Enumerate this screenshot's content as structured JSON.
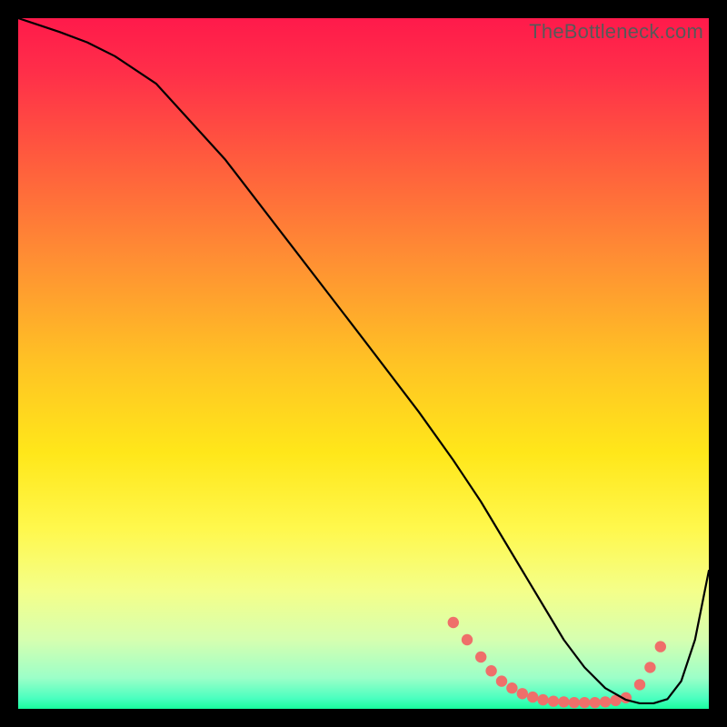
{
  "watermark": "TheBottleneck.com",
  "chart_data": {
    "type": "line",
    "title": "",
    "xlabel": "",
    "ylabel": "",
    "xlim": [
      0,
      100
    ],
    "ylim": [
      0,
      100
    ],
    "grid": false,
    "legend": false,
    "background_gradient_stops": [
      {
        "offset": 0,
        "color": "#ff1a4b"
      },
      {
        "offset": 0.08,
        "color": "#ff2f49"
      },
      {
        "offset": 0.2,
        "color": "#ff5a3e"
      },
      {
        "offset": 0.35,
        "color": "#ff8f33"
      },
      {
        "offset": 0.5,
        "color": "#ffc324"
      },
      {
        "offset": 0.63,
        "color": "#ffe71a"
      },
      {
        "offset": 0.74,
        "color": "#fff84d"
      },
      {
        "offset": 0.83,
        "color": "#f4ff8a"
      },
      {
        "offset": 0.9,
        "color": "#d6ffb0"
      },
      {
        "offset": 0.955,
        "color": "#9cffc8"
      },
      {
        "offset": 0.985,
        "color": "#4affbf"
      },
      {
        "offset": 1.0,
        "color": "#18ff9e"
      }
    ],
    "series": [
      {
        "name": "curve",
        "color": "#000000",
        "width": 2.2,
        "x": [
          0,
          3,
          6,
          10,
          14,
          20,
          30,
          40,
          50,
          58,
          63,
          67,
          70,
          73,
          76,
          79,
          82,
          85,
          88,
          90,
          92,
          94,
          96,
          98,
          100
        ],
        "y": [
          100,
          99,
          98,
          96.5,
          94.5,
          90.5,
          79.5,
          66.5,
          53.5,
          43,
          36,
          30,
          25,
          20,
          15,
          10,
          6,
          3,
          1.3,
          0.8,
          0.8,
          1.4,
          4,
          10,
          20
        ]
      }
    ],
    "markers": {
      "name": "trough-dots",
      "color": "#ef6f6a",
      "radius": 6.2,
      "points": [
        {
          "x": 63.0,
          "y": 12.5
        },
        {
          "x": 65.0,
          "y": 10.0
        },
        {
          "x": 67.0,
          "y": 7.5
        },
        {
          "x": 68.5,
          "y": 5.5
        },
        {
          "x": 70.0,
          "y": 4.0
        },
        {
          "x": 71.5,
          "y": 3.0
        },
        {
          "x": 73.0,
          "y": 2.2
        },
        {
          "x": 74.5,
          "y": 1.7
        },
        {
          "x": 76.0,
          "y": 1.3
        },
        {
          "x": 77.5,
          "y": 1.1
        },
        {
          "x": 79.0,
          "y": 1.0
        },
        {
          "x": 80.5,
          "y": 0.9
        },
        {
          "x": 82.0,
          "y": 0.9
        },
        {
          "x": 83.5,
          "y": 0.9
        },
        {
          "x": 85.0,
          "y": 1.0
        },
        {
          "x": 86.5,
          "y": 1.2
        },
        {
          "x": 88.0,
          "y": 1.6
        },
        {
          "x": 90.0,
          "y": 3.5
        },
        {
          "x": 91.5,
          "y": 6.0
        },
        {
          "x": 93.0,
          "y": 9.0
        }
      ]
    }
  }
}
